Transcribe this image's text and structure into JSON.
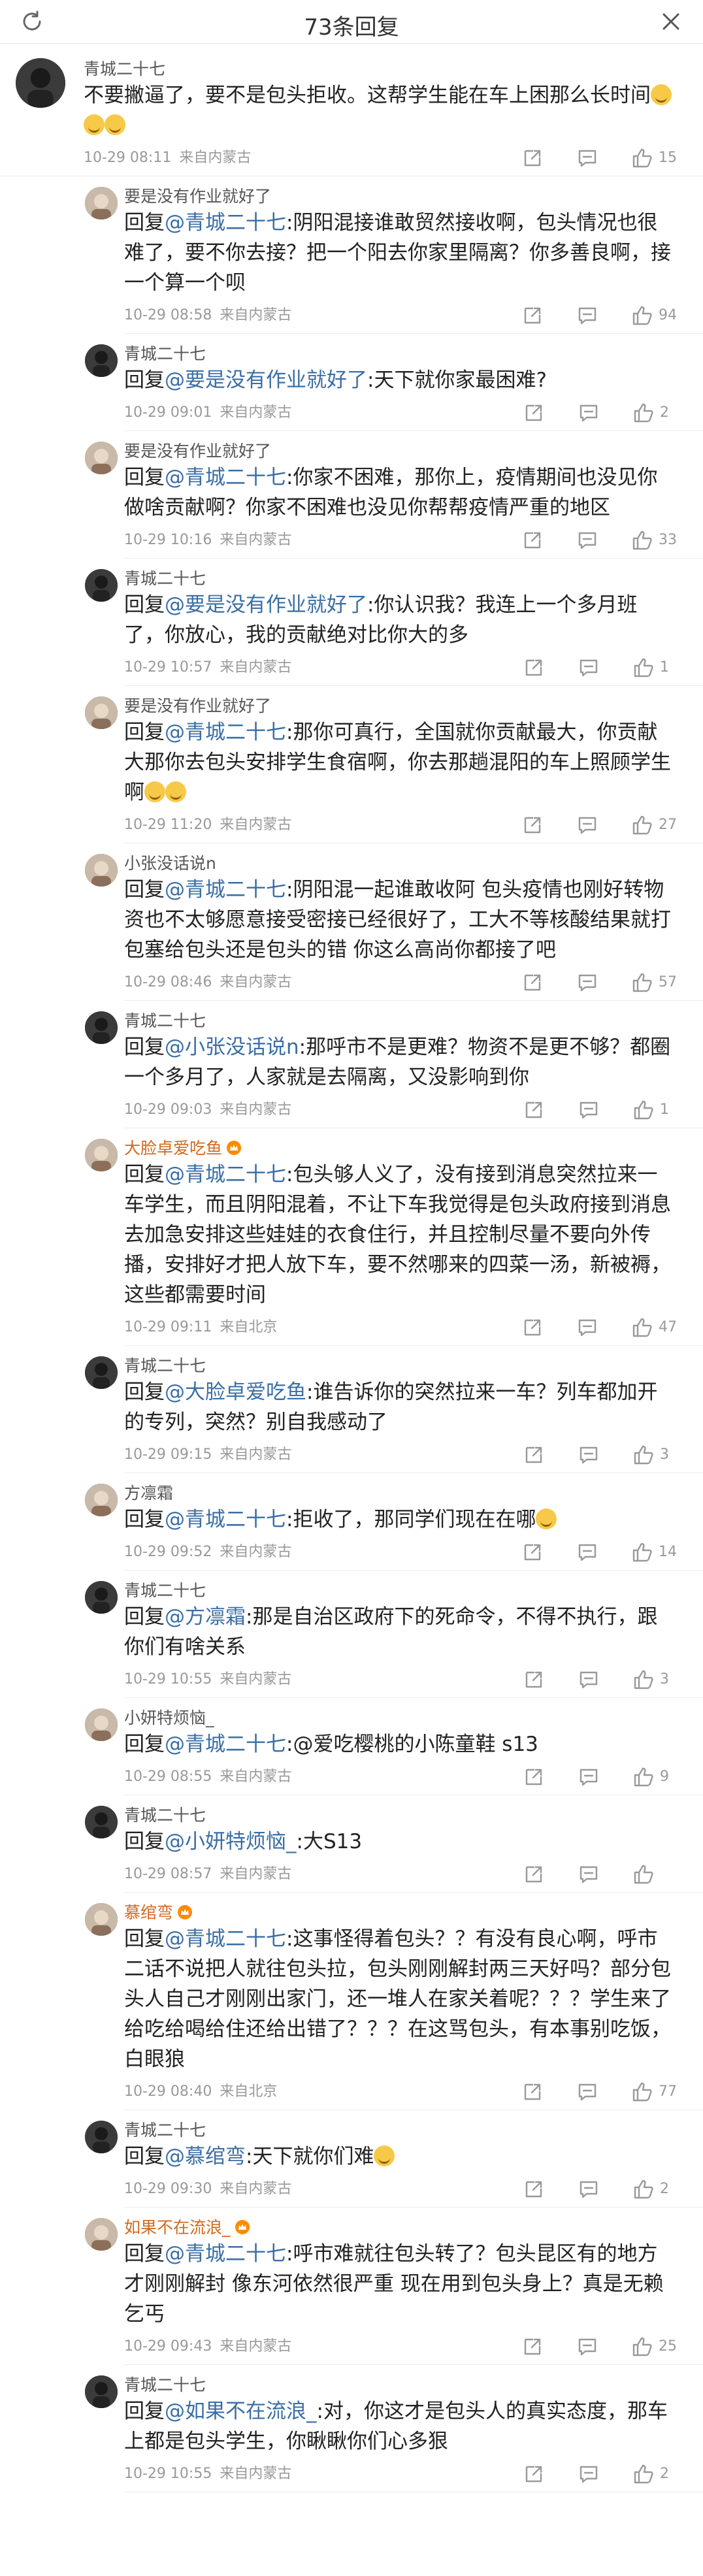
{
  "header": {
    "title": "73条回复"
  },
  "replies": [
    {
      "user": "青城二十七",
      "top": true,
      "text_pre": "",
      "at": "",
      "text": "不要撇逼了，要不是包头拒收。这帮学生能在车上困那么长时间",
      "date": "10-29 08:11",
      "loc": "来自内蒙古",
      "likes": "15",
      "emoji": 3
    },
    {
      "user": "要是没有作业就好了",
      "text_pre": "回复",
      "at": "@青城二十七",
      "text": ":阴阳混接谁敢贸然接收啊，包头情况也很难了，要不你去接？把一个阳去你家里隔离？你多善良啊，接一个算一个呗",
      "date": "10-29 08:58",
      "loc": "来自内蒙古",
      "likes": "94"
    },
    {
      "user": "青城二十七",
      "text_pre": "回复",
      "at": "@要是没有作业就好了",
      "text": ":天下就你家最困难?",
      "date": "10-29 09:01",
      "loc": "来自内蒙古",
      "likes": "2"
    },
    {
      "user": "要是没有作业就好了",
      "text_pre": "回复",
      "at": "@青城二十七",
      "text": ":你家不困难，那你上，疫情期间也没见你做啥贡献啊？你家不困难也没见你帮帮疫情严重的地区",
      "date": "10-29 10:16",
      "loc": "来自内蒙古",
      "likes": "33"
    },
    {
      "user": "青城二十七",
      "text_pre": "回复",
      "at": "@要是没有作业就好了",
      "text": ":你认识我？我连上一个多月班了，你放心，我的贡献绝对比你大的多",
      "date": "10-29 10:57",
      "loc": "来自内蒙古",
      "likes": "1"
    },
    {
      "user": "要是没有作业就好了",
      "text_pre": "回复",
      "at": "@青城二十七",
      "text": ":那你可真行，全国就你贡献最大，你贡献大那你去包头安排学生食宿啊，你去那趟混阳的车上照顾学生啊",
      "date": "10-29 11:20",
      "loc": "来自内蒙古",
      "likes": "27",
      "emoji": 2
    },
    {
      "user": "小张没话说n",
      "text_pre": "回复",
      "at": "@青城二十七",
      "text": ":阴阳混一起谁敢收阿 包头疫情也刚好转物资也不太够愿意接受密接已经很好了，工大不等核酸结果就打包塞给包头还是包头的错 你这么高尚你都接了吧",
      "date": "10-29 08:46",
      "loc": "来自内蒙古",
      "likes": "57"
    },
    {
      "user": "青城二十七",
      "text_pre": "回复",
      "at": "@小张没话说n",
      "text": ":那呼市不是更难？物资不是更不够？都圈一个多月了，人家就是去隔离，又没影响到你",
      "date": "10-29 09:03",
      "loc": "来自内蒙古",
      "likes": "1"
    },
    {
      "user": "大脸卓爱吃鱼",
      "vip": true,
      "text_pre": "回复",
      "at": "@青城二十七",
      "text": ":包头够人义了，没有接到消息突然拉来一车学生，而且阴阳混着，不让下车我觉得是包头政府接到消息去加急安排这些娃娃的衣食住行，并且控制尽量不要向外传播，安排好才把人放下车，要不然哪来的四菜一汤，新被褥，这些都需要时间",
      "date": "10-29 09:11",
      "loc": "来自北京",
      "likes": "47"
    },
    {
      "user": "青城二十七",
      "text_pre": "回复",
      "at": "@大脸卓爱吃鱼",
      "text": ":谁告诉你的突然拉来一车？列车都加开的专列，突然？别自我感动了",
      "date": "10-29 09:15",
      "loc": "来自内蒙古",
      "likes": "3"
    },
    {
      "user": "方凛霜",
      "text_pre": "回复",
      "at": "@青城二十七",
      "text": ":拒收了，那同学们现在在哪",
      "date": "10-29 09:52",
      "loc": "来自内蒙古",
      "likes": "14",
      "emoji": 1
    },
    {
      "user": "青城二十七",
      "text_pre": "回复",
      "at": "@方凛霜",
      "text": ":那是自治区政府下的死命令，不得不执行，跟你们有啥关系",
      "date": "10-29 10:55",
      "loc": "来自内蒙古",
      "likes": "3"
    },
    {
      "user": "小妍特烦恼_",
      "text_pre": "回复",
      "at": "@青城二十七",
      "text": ":@爱吃樱桃的小陈童鞋 s13",
      "date": "10-29 08:55",
      "loc": "来自内蒙古",
      "likes": "9"
    },
    {
      "user": "青城二十七",
      "text_pre": "回复",
      "at": "@小妍特烦恼_",
      "text": ":大S13",
      "date": "10-29 08:57",
      "loc": "来自内蒙古",
      "likes": ""
    },
    {
      "user": "慕绾弯",
      "vip": true,
      "text_pre": "回复",
      "at": "@青城二十七",
      "text": ":这事怪得着包头？？有没有良心啊，呼市二话不说把人就往包头拉，包头刚刚解封两三天好吗？部分包头人自己才刚刚出家门，还一堆人在家关着呢？？？学生来了给吃给喝给住还给出错了？？？在这骂包头，有本事别吃饭，白眼狼",
      "date": "10-29 08:40",
      "loc": "来自北京",
      "likes": "77"
    },
    {
      "user": "青城二十七",
      "text_pre": "回复",
      "at": "@慕绾弯",
      "text": ":天下就你们难",
      "date": "10-29 09:30",
      "loc": "来自内蒙古",
      "likes": "2",
      "emoji": 1
    },
    {
      "user": "如果不在流浪_",
      "vip": true,
      "text_pre": "回复",
      "at": "@青城二十七",
      "text": ":呼市难就往包头转了？包头昆区有的地方才刚刚解封 像东河依然很严重 现在用到包头身上？真是无赖乞丐",
      "date": "10-29 09:43",
      "loc": "来自内蒙古",
      "likes": "25"
    },
    {
      "user": "青城二十七",
      "text_pre": "回复",
      "at": "@如果不在流浪_",
      "text": ":对，你这才是包头人的真实态度，那车上都是包头学生，你瞅瞅你们心多狠",
      "date": "10-29 10:55",
      "loc": "来自内蒙古",
      "likes": "2"
    }
  ]
}
